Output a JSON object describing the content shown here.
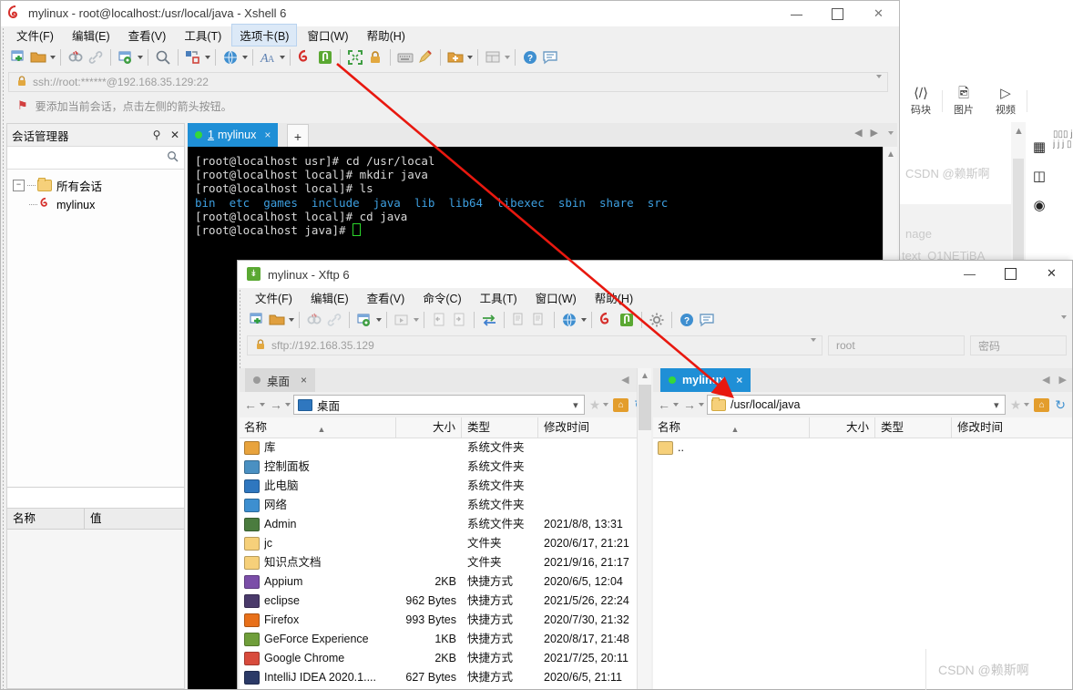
{
  "background_window": {
    "toolbar": [
      {
        "icon": "code-block-icon",
        "label": "码块"
      },
      {
        "icon": "image-icon",
        "label": "图片"
      },
      {
        "icon": "video-icon",
        "label": "视频"
      }
    ],
    "editor_watermark": "CSDN @赖斯啊",
    "body_line1": "nage",
    "body_line2": "text_Q1NETiBA"
  },
  "watermark": "CSDN @赖斯啊",
  "xshell": {
    "title": "mylinux - root@localhost:/usr/local/java - Xshell 6",
    "icon": "xshell-logo-icon",
    "window_buttons": {
      "minimize": "—",
      "maximize": "▢",
      "close": "✕"
    },
    "menu": [
      {
        "label": "文件(F)",
        "active": false
      },
      {
        "label": "编辑(E)",
        "active": false
      },
      {
        "label": "查看(V)",
        "active": false
      },
      {
        "label": "工具(T)",
        "active": false
      },
      {
        "label": "选项卡(B)",
        "active": true
      },
      {
        "label": "窗口(W)",
        "active": false
      },
      {
        "label": "帮助(H)",
        "active": false
      }
    ],
    "address": "ssh://root:******@192.168.35.129:22",
    "hint": "要添加当前会话，点击左侧的箭头按钮。",
    "session_manager": {
      "title": "会话管理器",
      "pin": "⇅",
      "close": "✕",
      "search_placeholder": "",
      "root_node": "所有会话",
      "child_node": "mylinux",
      "bottom_columns": [
        "名称",
        "值"
      ]
    },
    "tab": {
      "number": "1",
      "label": "mylinux",
      "close": "×",
      "add": "+"
    },
    "terminal_lines": [
      {
        "text": "[root@localhost usr]# cd /usr/local",
        "type": "plain"
      },
      {
        "text": "[root@localhost local]# mkdir java",
        "type": "plain"
      },
      {
        "text": "[root@localhost local]# ls",
        "type": "plain"
      },
      {
        "text": "bin  etc  games  include  java  lib  lib64  libexec  sbin  share  src",
        "type": "dir"
      },
      {
        "text": "[root@localhost local]# cd java",
        "type": "plain"
      },
      {
        "text": "[root@localhost java]# ",
        "type": "prompt"
      }
    ]
  },
  "xftp": {
    "title": "mylinux - Xftp 6",
    "icon": "xftp-logo-icon",
    "window_buttons": {
      "minimize": "—",
      "maximize": "▢",
      "close": "✕"
    },
    "menu": [
      {
        "label": "文件(F)"
      },
      {
        "label": "编辑(E)"
      },
      {
        "label": "查看(V)"
      },
      {
        "label": "命令(C)"
      },
      {
        "label": "工具(T)"
      },
      {
        "label": "窗口(W)"
      },
      {
        "label": "帮助(H)"
      }
    ],
    "url": "sftp://192.168.35.129",
    "user": "root",
    "password_placeholder": "密码",
    "left_pane": {
      "tab_label": "桌面",
      "tab_close": "×",
      "path": "桌面",
      "columns": [
        "名称",
        "大小",
        "类型",
        "修改时间"
      ],
      "rows": [
        {
          "name": "库",
          "size": "",
          "type": "系统文件夹",
          "modified": "",
          "icon": "library-icon",
          "color": "#e8a33d"
        },
        {
          "name": "控制面板",
          "size": "",
          "type": "系统文件夹",
          "modified": "",
          "icon": "control-panel-icon",
          "color": "#4a90c2"
        },
        {
          "name": "此电脑",
          "size": "",
          "type": "系统文件夹",
          "modified": "",
          "icon": "computer-icon",
          "color": "#2f77bf"
        },
        {
          "name": "网络",
          "size": "",
          "type": "系统文件夹",
          "modified": "",
          "icon": "network-icon",
          "color": "#3d8fd0"
        },
        {
          "name": "Admin",
          "size": "",
          "type": "系统文件夹",
          "modified": "2021/8/8, 13:31",
          "icon": "user-folder-icon",
          "color": "#4b7c3f"
        },
        {
          "name": "jc",
          "size": "",
          "type": "文件夹",
          "modified": "2020/6/17, 21:21",
          "icon": "folder-icon",
          "color": "#f6d07a"
        },
        {
          "name": "知识点文档",
          "size": "",
          "type": "文件夹",
          "modified": "2021/9/16, 21:17",
          "icon": "folder-icon",
          "color": "#f6d07a"
        },
        {
          "name": "Appium",
          "size": "2KB",
          "type": "快捷方式",
          "modified": "2020/6/5, 12:04",
          "icon": "appium-icon",
          "color": "#7b4ea8"
        },
        {
          "name": "eclipse",
          "size": "962 Bytes",
          "type": "快捷方式",
          "modified": "2021/5/26, 22:24",
          "icon": "eclipse-icon",
          "color": "#4a3a6b"
        },
        {
          "name": "Firefox",
          "size": "993 Bytes",
          "type": "快捷方式",
          "modified": "2020/7/30, 21:32",
          "icon": "firefox-icon",
          "color": "#e8701a"
        },
        {
          "name": "GeForce Experience",
          "size": "1KB",
          "type": "快捷方式",
          "modified": "2020/8/17, 21:48",
          "icon": "geforce-icon",
          "color": "#6f9e3a"
        },
        {
          "name": "Google Chrome",
          "size": "2KB",
          "type": "快捷方式",
          "modified": "2021/7/25, 20:11",
          "icon": "chrome-icon",
          "color": "#d84b3c"
        },
        {
          "name": "IntelliJ IDEA 2020.1....",
          "size": "627 Bytes",
          "type": "快捷方式",
          "modified": "2020/6/5, 21:11",
          "icon": "intellij-icon",
          "color": "#2b3a67"
        }
      ]
    },
    "right_pane": {
      "tab_label": "mylinux",
      "tab_close": "×",
      "path": "/usr/local/java",
      "columns": [
        "名称",
        "大小",
        "类型",
        "修改时间"
      ],
      "rows": [
        {
          "name": "..",
          "size": "",
          "type": "",
          "modified": "",
          "icon": "parent-folder-icon",
          "color": "#f6d07a"
        }
      ]
    }
  }
}
